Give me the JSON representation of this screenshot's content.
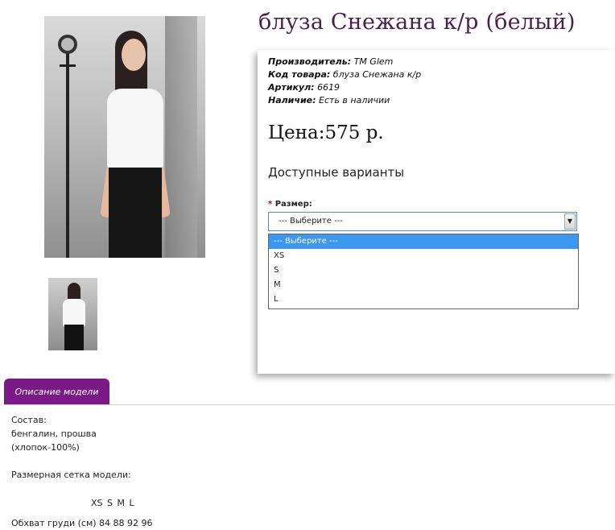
{
  "product": {
    "title": "блуза Снежана к/р (белый)",
    "meta": [
      {
        "label": "Производитель:",
        "value": "TM Glem"
      },
      {
        "label": "Код товара:",
        "value": "блуза Снежана к/р"
      },
      {
        "label": "Артикул:",
        "value": "6619"
      },
      {
        "label": "Наличие:",
        "value": "Есть в наличии"
      }
    ],
    "price": "Цена:575 р.",
    "variants_heading": "Доступные варианты",
    "size_required_marker": "*",
    "size_label": "Размер:",
    "size_selected": "--- Выберите ---",
    "size_options": [
      "--- Выберите ---",
      "XS",
      "S",
      "M",
      "L"
    ]
  },
  "tabs": {
    "description_label": "Описание модели"
  },
  "description": {
    "composition_heading": "Состав:",
    "composition_line1": "бенгалин, прошва",
    "composition_line2": "(хлопок-100%)",
    "size_grid_heading": "Размерная сетка модели:",
    "size_grid_header": "XS S M L",
    "bust_row": "Обхват груди (см) 84 88 92 96"
  }
}
